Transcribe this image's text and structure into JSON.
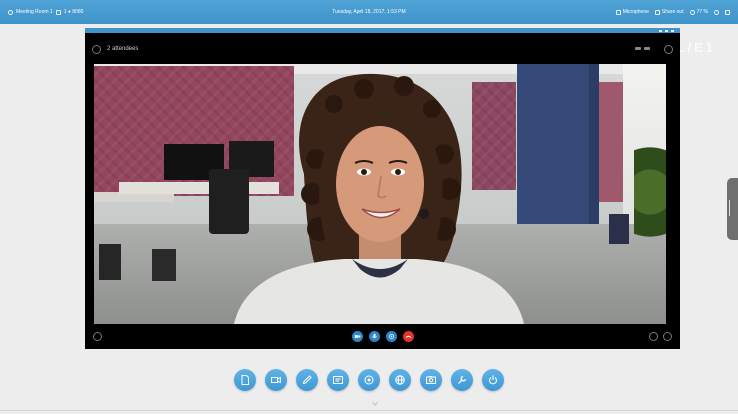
{
  "topbar": {
    "room_label": "Meeting Room 1",
    "ext_label": "1 ● 8080",
    "datetime": "Tuesday, April 18, 2017, 1:53 PM",
    "mic_label": "Microphone",
    "share_label": "Share out",
    "volume_label": "77 %"
  },
  "video": {
    "attendees_label": "2 attendees"
  },
  "background": {
    "brand": "CL/E1"
  },
  "colors": {
    "accent": "#3e93c9",
    "end_call": "#e0342e"
  },
  "call_controls": [
    "camera-icon",
    "mic-icon",
    "share-icon",
    "end-call-icon"
  ],
  "dock": [
    "document-icon",
    "video-icon",
    "pen-icon",
    "text-icon",
    "target-icon",
    "globe-icon",
    "photo-icon",
    "wrench-icon",
    "power-icon"
  ]
}
